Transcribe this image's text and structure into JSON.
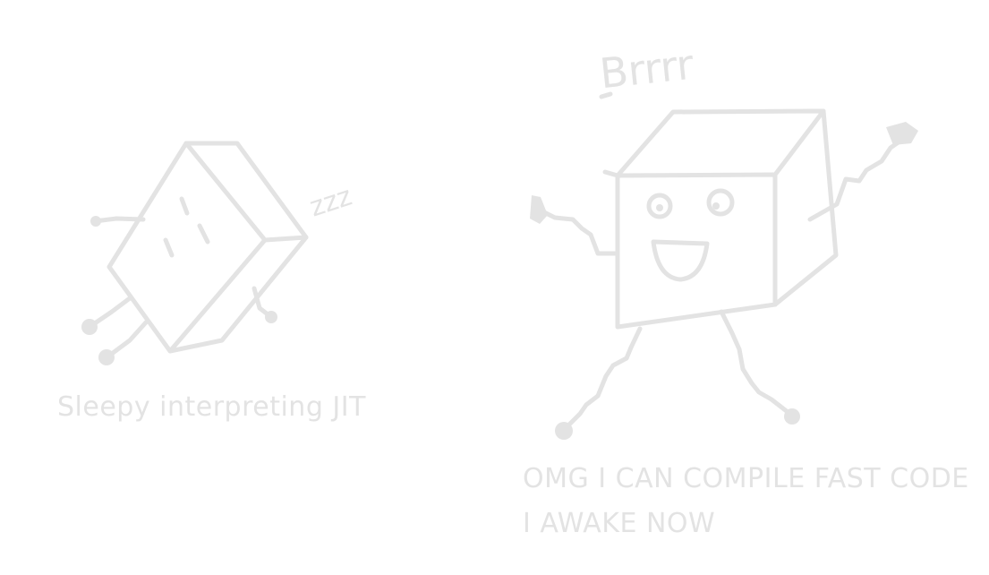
{
  "left_panel": {
    "caption": "Sleepy interpreting JIT",
    "sound_effect": "zzz"
  },
  "right_panel": {
    "caption_line1": "OMG I CAN COMPILE FAST CODE",
    "caption_line2": "I AWAKE NOW",
    "sound_effect": "Brrrr"
  },
  "colors": {
    "background": "#ffffff",
    "sketch": "#e3e3e3"
  }
}
